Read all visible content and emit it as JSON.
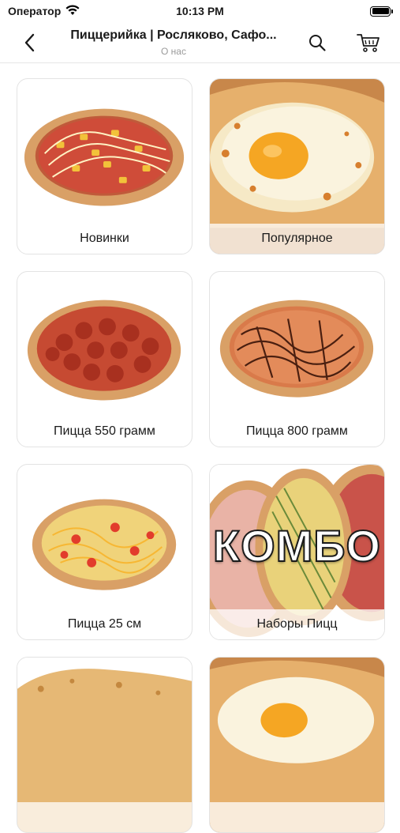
{
  "status_bar": {
    "carrier": "Оператор",
    "time": "10:13 PM",
    "battery_level": 1.0
  },
  "nav": {
    "title": "Пиццерийка | Росляково, Сафо...",
    "subtitle": "О нас"
  },
  "categories": [
    {
      "label": "Новинки"
    },
    {
      "label": "Популярное"
    },
    {
      "label": "Пицца 550 грамм"
    },
    {
      "label": "Пицца 800 грамм"
    },
    {
      "label": "Пицца 25 см"
    },
    {
      "label": "Наборы Пицц",
      "overlay_text": "КОМБО"
    },
    {
      "label": ""
    },
    {
      "label": ""
    }
  ],
  "colors": {
    "crust": "#d9a066",
    "sauce": "#c0392b",
    "cheese": "#f2d16b",
    "egg_yolk": "#f5a623"
  }
}
